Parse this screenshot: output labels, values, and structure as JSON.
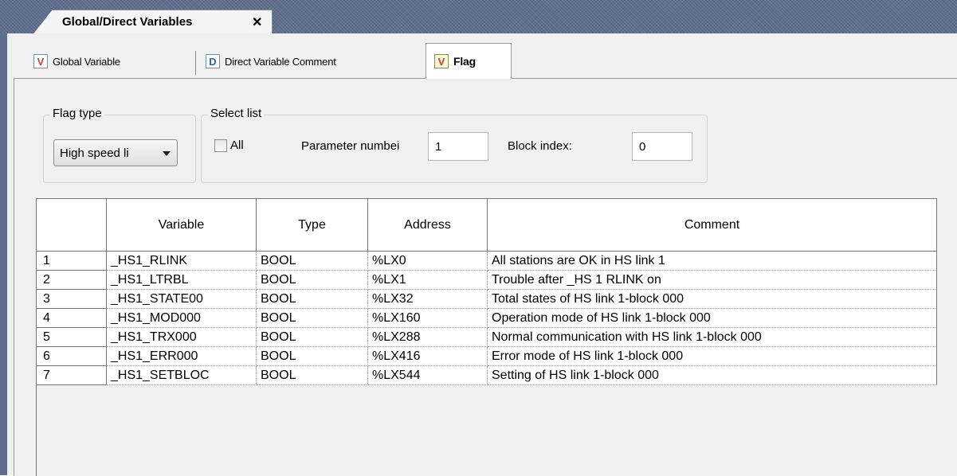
{
  "document_tab": {
    "title": "Global/Direct Variables",
    "close": "✕"
  },
  "tabs": [
    {
      "icon_letter": "V",
      "icon_color": "#d33a2c",
      "label": "Global Variable"
    },
    {
      "icon_letter": "D",
      "icon_color": "#2f63b0",
      "label": "Direct Variable Comment"
    },
    {
      "icon_letter": "V",
      "icon_color": "#d33a2c",
      "label": "Flag",
      "active": true
    }
  ],
  "flag_type": {
    "legend": "Flag type",
    "value": "High speed li"
  },
  "select_list": {
    "legend": "Select list",
    "all_label": "All",
    "all_checked": false,
    "param_label": "Parameter numbei",
    "param_value": "1",
    "block_label": "Block index:",
    "block_value": "0"
  },
  "table": {
    "columns": [
      "",
      "Variable",
      "Type",
      "Address",
      "Comment"
    ],
    "rows": [
      {
        "n": "1",
        "variable": "_HS1_RLINK",
        "type": "BOOL",
        "address": "%LX0",
        "comment": "All stations are OK in HS link 1"
      },
      {
        "n": "2",
        "variable": "_HS1_LTRBL",
        "type": "BOOL",
        "address": "%LX1",
        "comment": "Trouble after _HS 1 RLINK on"
      },
      {
        "n": "3",
        "variable": "_HS1_STATE00",
        "type": "BOOL",
        "address": "%LX32",
        "comment": "Total states of HS link 1-block 000"
      },
      {
        "n": "4",
        "variable": "_HS1_MOD000",
        "type": "BOOL",
        "address": "%LX160",
        "comment": "Operation mode of HS link 1-block 000"
      },
      {
        "n": "5",
        "variable": "_HS1_TRX000",
        "type": "BOOL",
        "address": "%LX288",
        "comment": "Normal communication with HS link 1-block 000"
      },
      {
        "n": "6",
        "variable": "_HS1_ERR000",
        "type": "BOOL",
        "address": "%LX416",
        "comment": "Error mode of HS link 1-block 000"
      },
      {
        "n": "7",
        "variable": "_HS1_SETBLOC",
        "type": "BOOL",
        "address": "%LX544",
        "comment": "Setting of HS link 1-block 000"
      }
    ]
  }
}
